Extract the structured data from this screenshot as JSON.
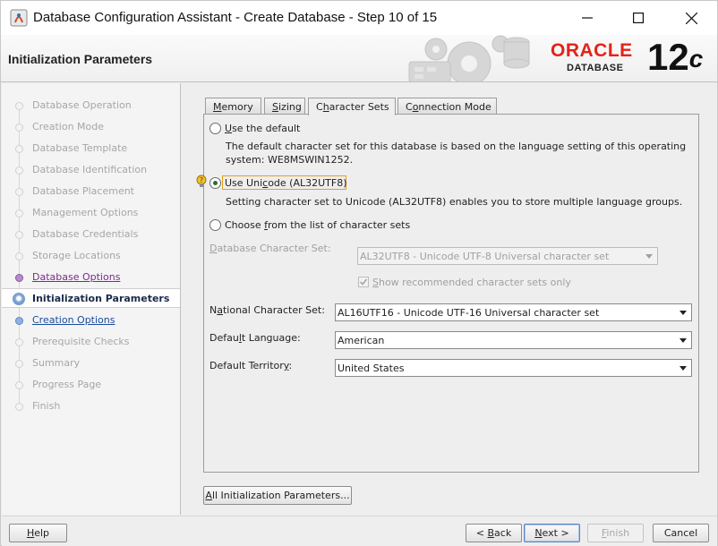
{
  "window": {
    "title": "Database Configuration Assistant - Create Database - Step 10 of 15",
    "controls": [
      "minimize",
      "maximize",
      "close"
    ]
  },
  "header": {
    "page_title": "Initialization Parameters",
    "brand": {
      "oracle": "ORACLE",
      "database": "DATABASE",
      "version": "12",
      "version_suffix": "c",
      "oracle_color": "#e2231a"
    }
  },
  "nav": {
    "items": [
      {
        "label": "Database Operation",
        "state": "disabled"
      },
      {
        "label": "Creation Mode",
        "state": "disabled"
      },
      {
        "label": "Database Template",
        "state": "disabled"
      },
      {
        "label": "Database Identification",
        "state": "disabled"
      },
      {
        "label": "Database Placement",
        "state": "disabled"
      },
      {
        "label": "Management Options",
        "state": "disabled"
      },
      {
        "label": "Database Credentials",
        "state": "disabled"
      },
      {
        "label": "Storage Locations",
        "state": "disabled"
      },
      {
        "label": "Database Options",
        "state": "visited"
      },
      {
        "label": "Initialization Parameters",
        "state": "current"
      },
      {
        "label": "Creation Options",
        "state": "next"
      },
      {
        "label": "Prerequisite Checks",
        "state": "disabled"
      },
      {
        "label": "Summary",
        "state": "disabled"
      },
      {
        "label": "Progress Page",
        "state": "disabled"
      },
      {
        "label": "Finish",
        "state": "disabled"
      }
    ]
  },
  "tabs": [
    {
      "label": "Memory",
      "mnemonic_index": 0
    },
    {
      "label": "Sizing",
      "mnemonic_index": 0
    },
    {
      "label": "Character Sets",
      "mnemonic_index": 1,
      "active": true
    },
    {
      "label": "Connection Mode",
      "mnemonic_index": 1
    }
  ],
  "charset": {
    "use_default": {
      "label_pre": "",
      "label_mn": "U",
      "label_post": "se the default",
      "description_line1": "The default character set for this database is based on the language setting of this operating",
      "description_line2": "system: WE8MSWIN1252."
    },
    "use_unicode": {
      "label_pre": "Use Uni",
      "label_mn": "c",
      "label_post": "ode (AL32UTF8)",
      "selected": true,
      "description": "Setting character set to Unicode (AL32UTF8) enables you to store multiple language groups."
    },
    "choose_from_list": {
      "label_pre": "Choose ",
      "label_mn": "f",
      "label_post": "rom the list of character sets"
    },
    "db_charset_label_pre": "",
    "db_charset_label_mn": "D",
    "db_charset_label_post": "atabase Character Set:",
    "db_charset_value": "AL32UTF8 - Unicode UTF-8 Universal character set",
    "show_recommended_pre": "",
    "show_recommended_mn": "S",
    "show_recommended_post": "how recommended character sets only",
    "show_recommended_checked": true,
    "national_label_pre": "N",
    "national_label_mn": "a",
    "national_label_post": "tional Character Set:",
    "national_value": "AL16UTF16 - Unicode UTF-16 Universal character set",
    "language_label_pre": "Defau",
    "language_label_mn": "l",
    "language_label_post": "t Language:",
    "language_value": "American",
    "territory_label_pre": "Default Territor",
    "territory_label_mn": "y",
    "territory_label_post": ":",
    "territory_value": "United States"
  },
  "all_params_button": {
    "pre": "",
    "mn": "A",
    "post": "ll Initialization Parameters..."
  },
  "footer": {
    "help": {
      "pre": "",
      "mn": "H",
      "post": "elp"
    },
    "back": {
      "pre": "< ",
      "mn": "B",
      "post": "ack"
    },
    "next": {
      "pre": "",
      "mn": "N",
      "post": "ext >"
    },
    "finish": {
      "pre": "",
      "mn": "F",
      "post": "inish"
    },
    "cancel": "Cancel"
  }
}
